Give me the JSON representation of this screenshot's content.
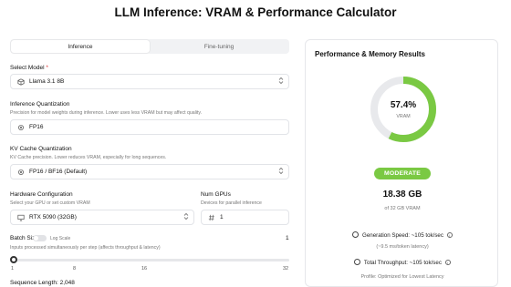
{
  "page": {
    "title": "LLM Inference: VRAM & Performance Calculator"
  },
  "tabs": [
    {
      "label": "Inference",
      "active": true
    },
    {
      "label": "Fine-tuning",
      "active": false
    }
  ],
  "form": {
    "model": {
      "label": "Select Model",
      "required_mark": "*",
      "value": "Llama 3.1 8B"
    },
    "quantization": {
      "label": "Inference Quantization",
      "hint": "Precision for model weights during inference. Lower uses less VRAM but may affect quality.",
      "value": "FP16"
    },
    "kv_cache": {
      "label": "KV Cache Quantization",
      "hint": "KV Cache precision. Lower reduces VRAM, especially for long sequences.",
      "value": "FP16 / BF16 (Default)"
    },
    "hardware": {
      "label": "Hardware Configuration",
      "hint": "Select your GPU or set custom VRAM",
      "value": "RTX 5090 (32GB)"
    },
    "num_gpus": {
      "label": "Num GPUs",
      "hint": "Devices for parallel inference",
      "value": "1"
    },
    "batch_size": {
      "label": "Batch Size:",
      "toggle_label": "Log Scale",
      "toggle_on": false,
      "value_display": "1",
      "hint": "Inputs processed simultaneously per step (affects throughput & latency)",
      "ticks": [
        "1",
        "8",
        "16",
        "32"
      ],
      "min": 1,
      "max": 32,
      "value": 1
    },
    "sequence_length": {
      "label": "Sequence Length: 2,048"
    }
  },
  "results": {
    "title": "Performance & Memory Results",
    "vram_percent": 57.4,
    "vram_percent_text": "57.4%",
    "gauge_label": "VRAM",
    "status_badge": "MODERATE",
    "vram_used": "18.38 GB",
    "vram_of": "of 32 GB VRAM",
    "generation_speed": "Generation Speed: ~105 tok/sec",
    "token_latency": "(~9.5 ms/token latency)",
    "total_throughput": "Total Throughput: ~105 tok/sec",
    "profile": "Profile: Optimized for Lowest Latency"
  },
  "colors": {
    "accent_green": "#7ac943",
    "gauge_track": "#e8e9ec"
  },
  "icons": {
    "model": "cube-icon",
    "quantization": "settings-icon",
    "kv_cache": "settings-icon",
    "hardware": "monitor-icon",
    "num_gpus": "hash-icon",
    "speed": "clock-icon",
    "throughput": "clock-icon",
    "info": "info-icon"
  }
}
